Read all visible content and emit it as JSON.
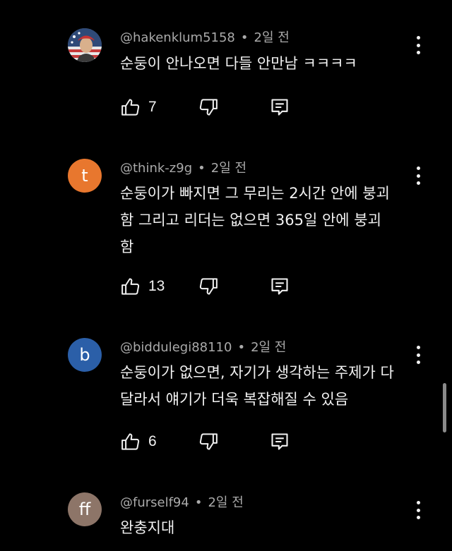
{
  "comments": [
    {
      "handle": "@hakenklum5158",
      "time": "2일 전",
      "text": "순둥이 안나오면 다들 안만남 ㅋㅋㅋㅋ",
      "likes": "7",
      "avatar": {
        "type": "photo",
        "color": "#6b7a8c"
      }
    },
    {
      "handle": "@think-z9g",
      "time": "2일 전",
      "text": "순둥이가 빠지면 그 무리는 2시간 안에 붕괴\n함 그리고 리더는 없으면 365일 안에 붕괴\n함",
      "likes": "13",
      "avatar": {
        "type": "letter",
        "letter": "t",
        "color": "#e8772e"
      }
    },
    {
      "handle": "@biddulegi88110",
      "time": "2일 전",
      "text": "순둥이가 없으면, 자기가 생각하는 주제가 다\n달라서 얘기가 더욱 복잡해질 수 있음",
      "likes": "6",
      "avatar": {
        "type": "letter",
        "letter": "b",
        "color": "#2b5fa8"
      }
    },
    {
      "handle": "@furself94",
      "time": "2일 전",
      "text": "완충지대",
      "likes": "",
      "avatar": {
        "type": "letter",
        "letter": "ff",
        "color": "#8d7568"
      }
    }
  ],
  "separator": "•",
  "icons": {
    "like": "thumb-up-icon",
    "dislike": "thumb-down-icon",
    "reply": "reply-icon",
    "menu": "more-vert-icon"
  },
  "colors": {
    "background": "#000000",
    "text": "#f1f1f1",
    "meta": "#aaaaaa"
  }
}
